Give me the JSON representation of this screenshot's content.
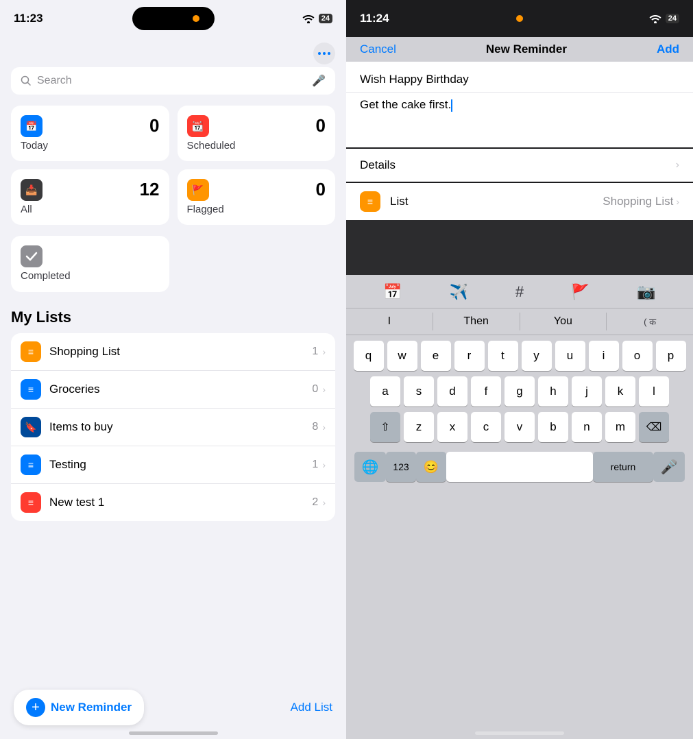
{
  "left": {
    "status": {
      "time": "11:23",
      "wifi": "wifi",
      "battery": "24"
    },
    "search": {
      "placeholder": "Search"
    },
    "smart_lists": [
      {
        "id": "today",
        "label": "Today",
        "count": "0",
        "icon_color": "blue"
      },
      {
        "id": "scheduled",
        "label": "Scheduled",
        "count": "0",
        "icon_color": "red"
      },
      {
        "id": "all",
        "label": "All",
        "count": "12",
        "icon_color": "dark"
      },
      {
        "id": "flagged",
        "label": "Flagged",
        "count": "0",
        "icon_color": "orange"
      }
    ],
    "completed": {
      "label": "Completed",
      "icon_color": "gray"
    },
    "my_lists_title": "My Lists",
    "lists": [
      {
        "name": "Shopping List",
        "count": "1",
        "icon_color": "orange"
      },
      {
        "name": "Groceries",
        "count": "0",
        "icon_color": "blue"
      },
      {
        "name": "Items to buy",
        "count": "8",
        "icon_color": "darkblue"
      },
      {
        "name": "Testing",
        "count": "1",
        "icon_color": "blue"
      },
      {
        "name": "New test 1",
        "count": "2",
        "icon_color": "red"
      }
    ],
    "bottom": {
      "new_reminder": "New Reminder",
      "add_list": "Add List"
    }
  },
  "right": {
    "status": {
      "time": "11:24",
      "wifi": "wifi",
      "battery": "24"
    },
    "nav": {
      "cancel": "Cancel",
      "title": "New Reminder",
      "add": "Add"
    },
    "form": {
      "title_text": "Wish Happy Birthday",
      "notes_text": "Get the cake first.",
      "details_label": "Details"
    },
    "list_row": {
      "label": "List",
      "value": "Shopping List"
    },
    "keyboard": {
      "suggestions": [
        "I",
        "Then",
        "You",
        "( क"
      ],
      "row1": [
        "q",
        "w",
        "e",
        "r",
        "t",
        "y",
        "u",
        "i",
        "o",
        "p"
      ],
      "row2": [
        "a",
        "s",
        "d",
        "f",
        "g",
        "h",
        "j",
        "k",
        "l"
      ],
      "row3": [
        "z",
        "x",
        "c",
        "v",
        "b",
        "n",
        "m"
      ],
      "shift_label": "⇧",
      "delete_label": "⌫",
      "numbers_label": "123",
      "emoji_label": "😊",
      "space_label": "",
      "return_label": "return",
      "globe_label": "🌐",
      "mic_label": "🎤"
    }
  }
}
